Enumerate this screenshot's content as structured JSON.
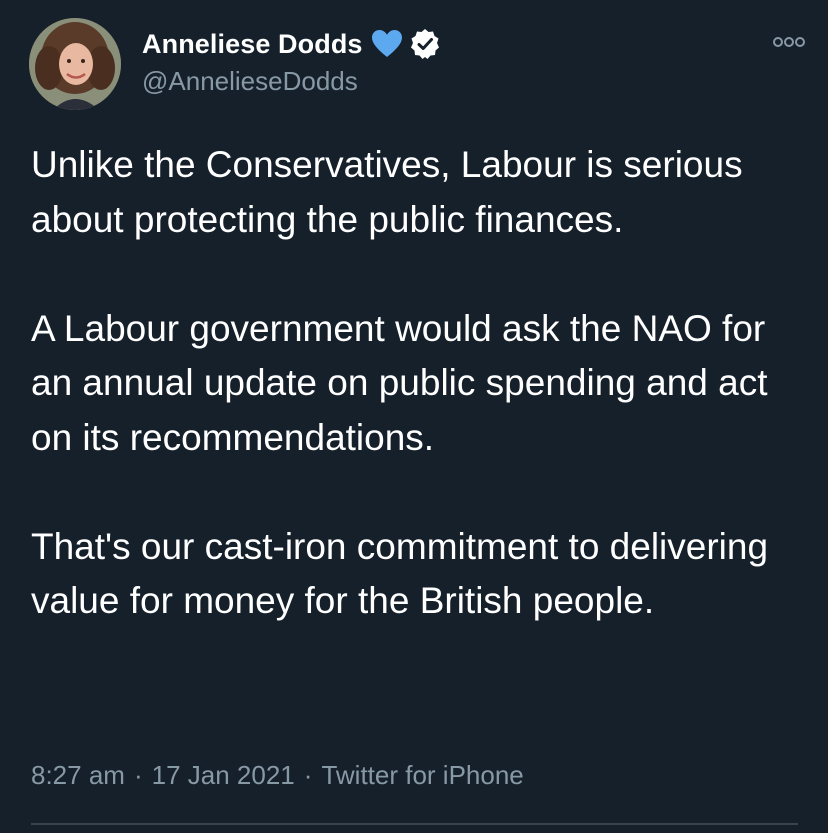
{
  "author": {
    "display_name": "Anneliese Dodds",
    "handle": "@AnnelieseDodds",
    "name_emoji": "blue-heart-icon",
    "verified": true
  },
  "tweet": {
    "paragraphs": [
      "Unlike the Conservatives, Labour is serious about protecting the public finances.",
      "A Labour government would ask the NAO for an annual update on public spending and act on its recommendations.",
      "That's our cast-iron commitment to delivering value for money for the British people."
    ]
  },
  "meta": {
    "time": "8:27 am",
    "date": "17 Jan 2021",
    "source": "Twitter for iPhone",
    "separator": "·"
  },
  "colors": {
    "background": "#15202b",
    "text": "#ffffff",
    "secondary_text": "#8899a6",
    "heart": "#5da9f0",
    "divider": "#38444d"
  }
}
